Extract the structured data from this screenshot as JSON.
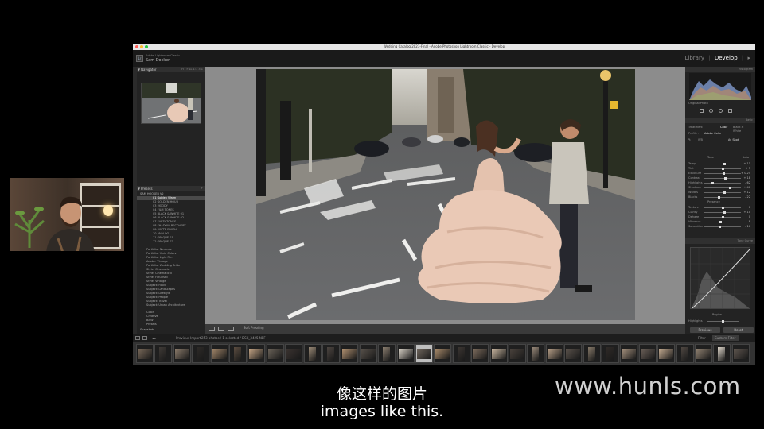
{
  "window": {
    "title": "Wedding Catalog 2023-Final - Adobe Photoshop Lightroom Classic - Develop"
  },
  "identity": {
    "caption": "Adobe Lightroom Classic",
    "name": "Sam Docker"
  },
  "modules": {
    "library": "Library",
    "separator": "|",
    "develop": "Develop",
    "more": "▸"
  },
  "left_panel": {
    "navigator": {
      "title": "Navigator",
      "zoom_options": "FIT  FILL  1:1  3:1"
    },
    "presets": {
      "title": "Presets",
      "add": "+",
      "groups_top": [
        {
          "label": "SAM HOOKER V2",
          "active": false
        },
        {
          "label": "01 Golden Warm",
          "active": true
        },
        {
          "label": "02 GOLDEN HOUR"
        },
        {
          "label": "03 MOODY"
        },
        {
          "label": "04 FILM TONES"
        },
        {
          "label": "05 BLACK & WHITE 01"
        },
        {
          "label": "06 BLACK & WHITE 02"
        },
        {
          "label": "07 EARTHTONES"
        },
        {
          "label": "08 SHADOW RECOVERY"
        },
        {
          "label": "09 MATTE FINISH"
        },
        {
          "label": "10 ANALOG"
        },
        {
          "label": "11 OPAQUE 01"
        },
        {
          "label": "12 OPAQUE 02"
        }
      ],
      "groups_bottom": [
        "Portfolio: Neutrals",
        "Portfolio: Vivid Colors",
        "Portfolio: Light Film",
        "Adobe: Vintage",
        "Portfolio: Wedding Bride",
        "Style: Cinematic",
        "Style: Cinematic II",
        "Style: Futuristic",
        "Style: Vintage",
        "Subject: Food",
        "Subject: Landscapes",
        "Subject: Lifestyle",
        "Subject: People",
        "Subject: Travel",
        "Subject: Urban Architecture"
      ],
      "groups_user": [
        "Color",
        "Creative",
        "B&W",
        "Presets"
      ],
      "snapshots": "Snapshots"
    },
    "buttons": {
      "copy": "Copy...",
      "paste": "Paste"
    }
  },
  "toolbar": {
    "soft_proofing": "Soft Proofing"
  },
  "right_panel": {
    "histogram": {
      "title": "Histogram",
      "original": "Original Photo"
    },
    "basic": {
      "title": "Basic",
      "treatment": "Treatment :",
      "color": "Color",
      "bw": "Black & White",
      "profile_label": "Profile :",
      "profile_value": "Adobe Color",
      "wb_label": "WB :",
      "wb_value": "As Shot",
      "tone": "Tone",
      "auto": "Auto",
      "presence": "Presence",
      "sliders": [
        {
          "label": "Temp",
          "value": "+ 11",
          "pos": 0.56
        },
        {
          "label": "Tint",
          "value": "+ 5",
          "pos": 0.52
        },
        {
          "label": "Exposure",
          "value": "+ 0.25",
          "pos": 0.54
        },
        {
          "label": "Contrast",
          "value": "+ 18",
          "pos": 0.58
        },
        {
          "label": "Highlights",
          "value": "- 62",
          "pos": 0.2
        },
        {
          "label": "Shadows",
          "value": "+ 46",
          "pos": 0.73
        },
        {
          "label": "Whites",
          "value": "+ 12",
          "pos": 0.56
        },
        {
          "label": "Blacks",
          "value": "- 22",
          "pos": 0.4
        },
        {
          "label": "Texture",
          "value": "0",
          "pos": 0.5
        },
        {
          "label": "Clarity",
          "value": "+ 10",
          "pos": 0.55
        },
        {
          "label": "Dehaze",
          "value": "0",
          "pos": 0.5
        },
        {
          "label": "Vibrance",
          "value": "- 8",
          "pos": 0.45
        },
        {
          "label": "Saturation",
          "value": "- 16",
          "pos": 0.42
        }
      ]
    },
    "tone_curve": {
      "title": "Tone Curve",
      "region": "Region",
      "highlights": "Highlights"
    },
    "buttons": {
      "previous": "Previous",
      "reset": "Reset"
    }
  },
  "filmstrip": {
    "source": "Previous Import",
    "count": "253 photos / 1 selected / DSC_3425.NEF",
    "filter_label": "Filter :",
    "filter_value": "Custom Filter"
  },
  "subtitles": {
    "chinese": "像这样的图片",
    "english": "images like this."
  },
  "watermark": "www.hunls.com",
  "colors": {
    "accent": "#ffffff",
    "panel": "#232323",
    "photo_bg": "#8c8c8c"
  }
}
